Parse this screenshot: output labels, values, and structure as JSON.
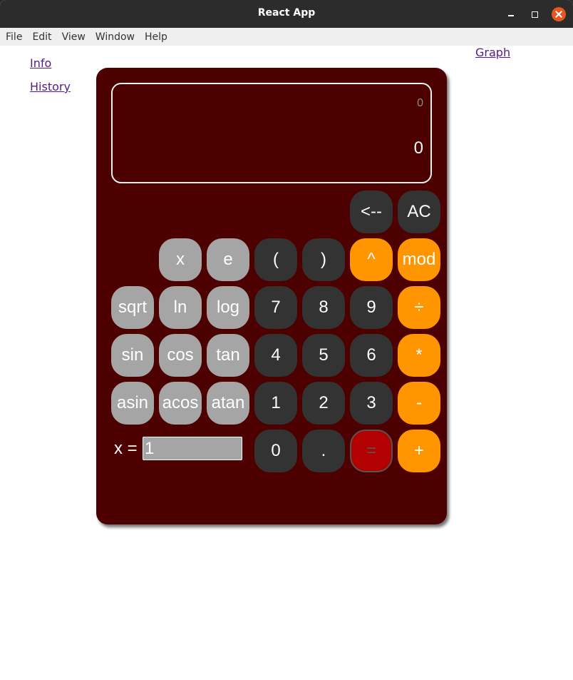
{
  "window": {
    "title": "React App"
  },
  "menu": [
    "File",
    "Edit",
    "View",
    "Window",
    "Help"
  ],
  "links": {
    "info": "Info",
    "history": "History",
    "graph": "Graph"
  },
  "display": {
    "expression": "0",
    "result": "0"
  },
  "buttons": {
    "backspace": "<--",
    "clear": "AC",
    "x": "x",
    "e": "e",
    "lparen": "(",
    "rparen": ")",
    "pow": "^",
    "mod": "mod",
    "sqrt": "sqrt",
    "ln": "ln",
    "log": "log",
    "seven": "7",
    "eight": "8",
    "nine": "9",
    "divide": "÷",
    "sin": "sin",
    "cos": "cos",
    "tan": "tan",
    "four": "4",
    "five": "5",
    "six": "6",
    "multiply": "*",
    "asin": "asin",
    "acos": "acos",
    "atan": "atan",
    "one": "1",
    "two": "2",
    "three": "3",
    "minus": "-",
    "zero": "0",
    "dot": ".",
    "equals": "=",
    "plus": "+"
  },
  "variable": {
    "label": "x =",
    "value": "1"
  },
  "colors": {
    "calculator_body": "#4d0000",
    "function_key": "#a5a5a5",
    "number_key": "#333333",
    "operator_key": "#ff9500",
    "equals_key": "#b30000"
  }
}
